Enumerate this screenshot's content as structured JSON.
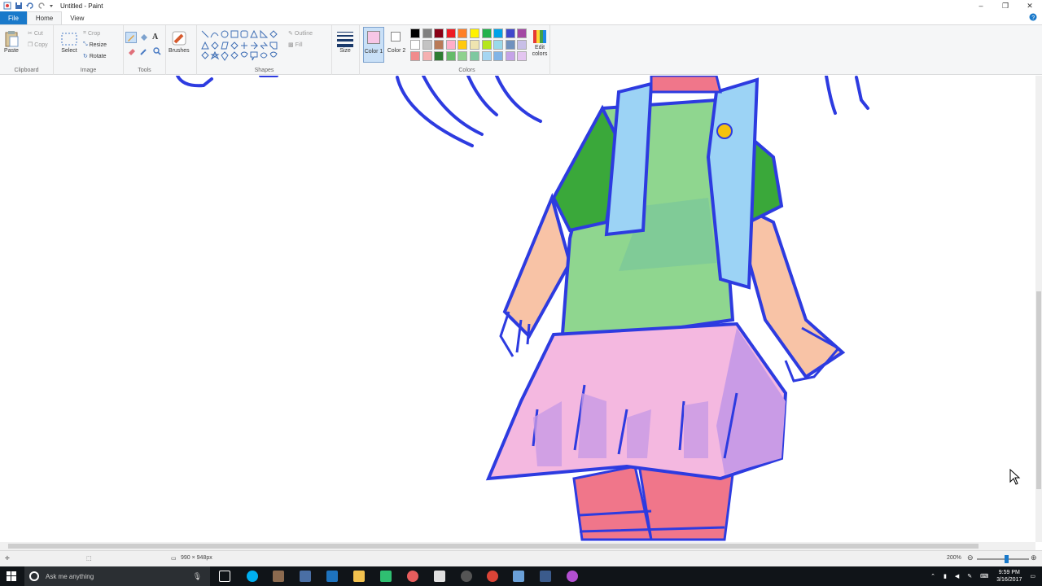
{
  "window": {
    "title": "Untitled - Paint"
  },
  "tabs": [
    {
      "label": "File"
    },
    {
      "label": "Home"
    },
    {
      "label": "View"
    }
  ],
  "ribbon": {
    "clipboard": {
      "paste": "Paste",
      "cut": "Cut",
      "copy": "Copy",
      "label": "Clipboard"
    },
    "image": {
      "select": "Select",
      "crop": "Crop",
      "resize": "Resize",
      "rotate": "Rotate",
      "label": "Image"
    },
    "tools": {
      "label": "Tools"
    },
    "brushes": {
      "label": "Brushes"
    },
    "shapes": {
      "outline": "Outline",
      "fill": "Fill",
      "label": "Shapes"
    },
    "size": {
      "label": "Size"
    },
    "color1": {
      "label": "Color 1",
      "value": "#f7c6e6"
    },
    "color2": {
      "label": "Color 2",
      "value": "#ffffff"
    },
    "colors": {
      "label": "Colors",
      "row1": [
        "#000000",
        "#7f7f7f",
        "#880015",
        "#ed1c24",
        "#ff7f27",
        "#fff200",
        "#22b14c",
        "#00a2e8",
        "#3f48cc",
        "#a349a4"
      ],
      "row2": [
        "#ffffff",
        "#c3c3c3",
        "#b97a57",
        "#ffaec9",
        "#ffc90e",
        "#efe4b0",
        "#b5e61d",
        "#99d9ea",
        "#7092be",
        "#c8bfe7"
      ],
      "row3": [
        "#f08c8c",
        "#f5b0b0",
        "#2e7d32",
        "#66bb6a",
        "#8fd18f",
        "#7ec8a0",
        "#a5d6f2",
        "#81b4e6",
        "#c5a3e8",
        "#e3c5f0"
      ]
    },
    "edit_colors": "Edit colors"
  },
  "status": {
    "dimensions": "990 × 948px",
    "zoom": "200%"
  },
  "taskbar": {
    "search_placeholder": "Ask me anything",
    "time": "9:59 PM",
    "date": "3/16/2017"
  }
}
